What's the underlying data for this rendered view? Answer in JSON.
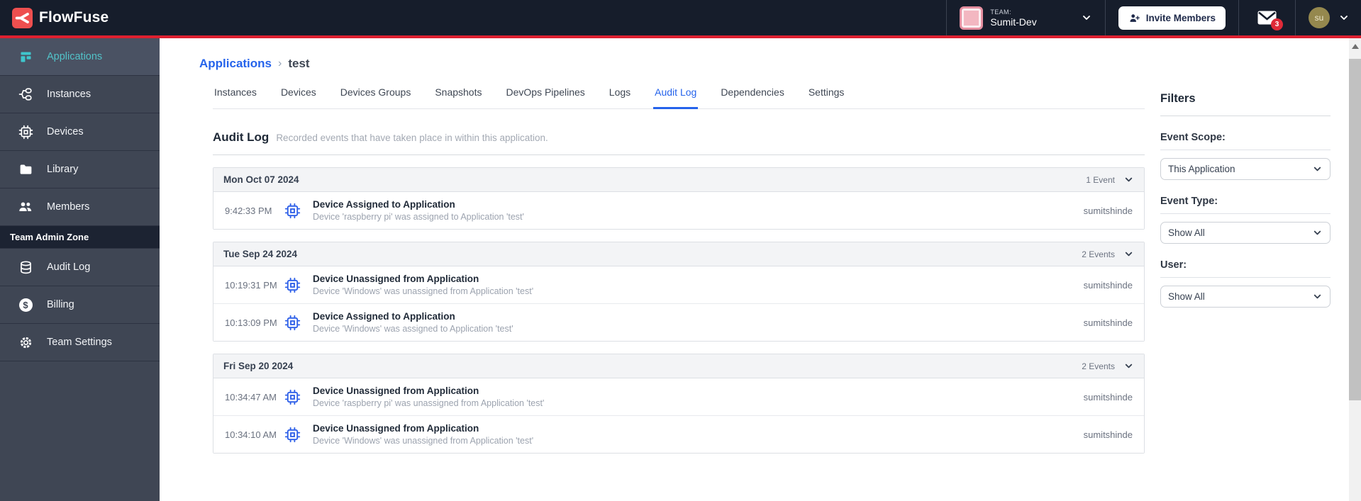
{
  "navbar": {
    "brand": "FlowFuse",
    "team_caption": "TEAM:",
    "team_name": "Sumit-Dev",
    "invite_label": "Invite Members",
    "notification_count": "3",
    "avatar_initials": "su"
  },
  "sidebar": {
    "items": [
      {
        "label": "Applications",
        "icon": "applications-icon",
        "active": true
      },
      {
        "label": "Instances",
        "icon": "instances-icon",
        "active": false
      },
      {
        "label": "Devices",
        "icon": "devices-icon",
        "active": false
      },
      {
        "label": "Library",
        "icon": "library-icon",
        "active": false
      },
      {
        "label": "Members",
        "icon": "members-icon",
        "active": false
      }
    ],
    "admin_zone_label": "Team Admin Zone",
    "admin_items": [
      {
        "label": "Audit Log",
        "icon": "audit-log-icon",
        "active": false
      },
      {
        "label": "Billing",
        "icon": "billing-icon",
        "active": false
      },
      {
        "label": "Team Settings",
        "icon": "settings-icon",
        "active": false
      }
    ]
  },
  "breadcrumb": {
    "parent": "Applications",
    "separator": "›",
    "current": "test"
  },
  "tabs": {
    "labels": [
      "Instances",
      "Devices",
      "Devices Groups",
      "Snapshots",
      "DevOps Pipelines",
      "Logs",
      "Audit Log",
      "Dependencies",
      "Settings"
    ],
    "active": "Audit Log"
  },
  "page": {
    "title": "Audit Log",
    "subtitle": "Recorded events that have taken place in within this application."
  },
  "audit_groups": [
    {
      "date": "Mon Oct 07 2024",
      "count_label": "1 Event",
      "events": [
        {
          "time": "9:42:33 PM",
          "title": "Device Assigned to Application",
          "description": "Device 'raspberry pi' was assigned to Application 'test'",
          "user": "sumitshinde"
        }
      ]
    },
    {
      "date": "Tue Sep 24 2024",
      "count_label": "2 Events",
      "events": [
        {
          "time": "10:19:31 PM",
          "title": "Device Unassigned from Application",
          "description": "Device 'Windows' was unassigned from Application 'test'",
          "user": "sumitshinde"
        },
        {
          "time": "10:13:09 PM",
          "title": "Device Assigned to Application",
          "description": "Device 'Windows' was assigned to Application 'test'",
          "user": "sumitshinde"
        }
      ]
    },
    {
      "date": "Fri Sep 20 2024",
      "count_label": "2 Events",
      "events": [
        {
          "time": "10:34:47 AM",
          "title": "Device Unassigned from Application",
          "description": "Device 'raspberry pi' was unassigned from Application 'test'",
          "user": "sumitshinde"
        },
        {
          "time": "10:34:10 AM",
          "title": "Device Unassigned from Application",
          "description": "Device 'Windows' was unassigned from Application 'test'",
          "user": "sumitshinde"
        }
      ]
    }
  ],
  "filters": {
    "title": "Filters",
    "fields": [
      {
        "label": "Event Scope:",
        "value": "This Application"
      },
      {
        "label": "Event Type:",
        "value": "Show All"
      },
      {
        "label": "User:",
        "value": "Show All"
      }
    ]
  },
  "colors": {
    "navbar_bg": "#161d2b",
    "brand_red": "#dd2030",
    "sidebar_bg": "#3f4654",
    "sidebar_active_teal": "#52c3c9",
    "link_blue": "#2563eb",
    "event_icon_blue": "#2d5fe8",
    "badge_red": "#e02a38",
    "avatar_olive": "#95884e"
  }
}
